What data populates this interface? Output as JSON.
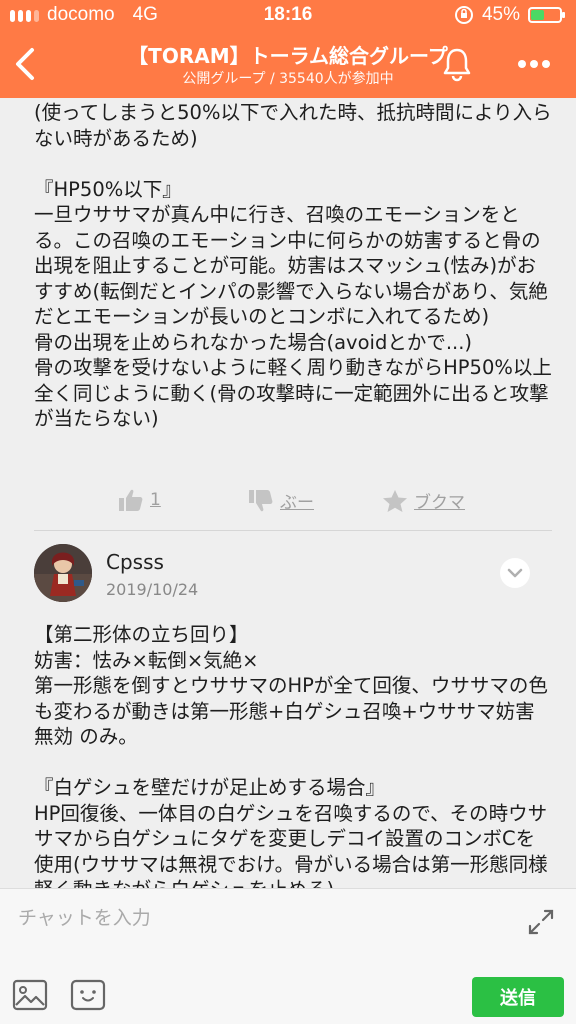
{
  "status_bar": {
    "carrier": "docomo",
    "network": "4G",
    "time": "18:16",
    "battery_percent": "45%",
    "battery_level": 0.45
  },
  "header": {
    "title": "【TORAM】トーラム総合グループ",
    "subtitle": "公開グループ / 35540人が参加中"
  },
  "post_1": {
    "text": "(使ってしまうと50%以下で入れた時、抵抗時間により入らない時があるため)\n\n『HP50%以下』\n一旦ウササマが真ん中に行き、召喚のエモーションをとる。この召喚のエモーション中に何らかの妨害すると骨の出現を阻止することが可能。妨害はスマッシュ(怯み)がおすすめ(転倒だとインパの影響で入らない場合があり、気絶だとエモーションが長いのとコンボに入れてるため)\n骨の出現を止められなかった場合(avoidとかで...)\n骨の攻撃を受けないように軽く周り動きながらHP50%以上全く同じように動く(骨の攻撃時に一定範囲外に出ると攻撃が当たらない)",
    "like_count": "1",
    "boo_label": "ぶー",
    "bookmark_label": "ブクマ"
  },
  "post_2": {
    "author": "Cpsss",
    "date": "2019/10/24",
    "text": "【第二形体の立ち回り】\n妨害：怯み×転倒×気絶×\n第一形態を倒すとウササマのHPが全て回復、ウササマの色も変わるが動きは第一形態+白ゲシュ召喚+ウササマ妨害無効 のみ。\n\n『白ゲシュを壁だけが足止めする場合』\nHP回復後、一体目の白ゲシュを召喚するので、その時ウササマから白ゲシュにタゲを変更しデコイ設置のコンボCを使用(ウササマは無視でおけ。骨がいる場合は第一形態同様軽く動きながら白ゲシュを止める)"
  },
  "input_bar": {
    "placeholder": "チャットを入力",
    "send_label": "送信"
  },
  "colors": {
    "header": "#ff7a45",
    "send": "#2bc044",
    "battery_fill": "#4cd964"
  },
  "icons": [
    "back-icon",
    "bell-icon",
    "more-icon",
    "thumbs-up-icon",
    "thumbs-down-icon",
    "star-icon",
    "chevron-down-icon",
    "expand-icon",
    "image-icon",
    "emoji-icon"
  ]
}
